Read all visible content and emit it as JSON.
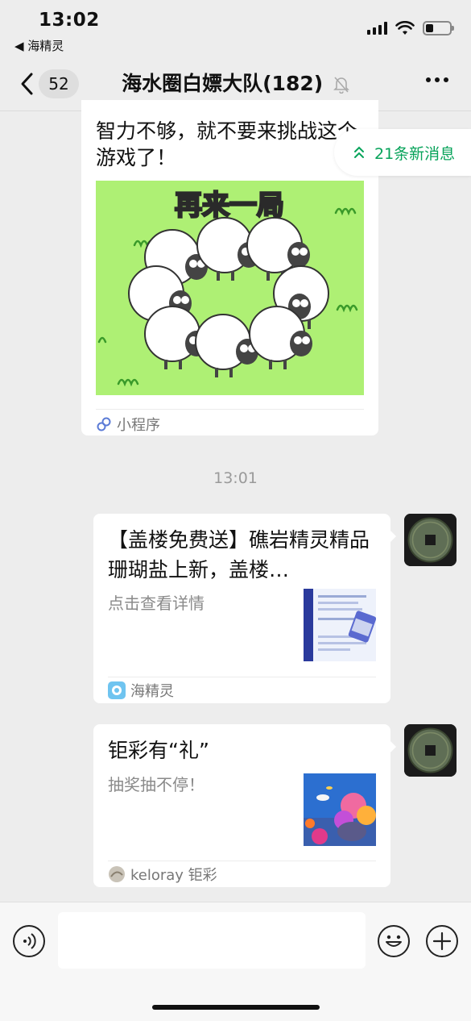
{
  "status_bar": {
    "time": "13:02",
    "back_app": "◀ 海精灵"
  },
  "nav": {
    "unread_count": "52",
    "title": "海水圈白嫖大队",
    "member_count": "(182)"
  },
  "new_messages": {
    "label": "21条新消息"
  },
  "messages": [
    {
      "text": "智力不够，就不要来挑战这个游戏了！",
      "image_caption": "再来一局",
      "footer": "小程序"
    },
    {
      "title": "【盖楼免费送】礁岩精灵精品珊瑚盐上新，盖楼…",
      "desc": "点击查看详情",
      "footer": "海精灵"
    },
    {
      "title": "钜彩有“礼”",
      "desc": "抽奖抽不停！",
      "footer": "keloray 钜彩"
    }
  ],
  "timestamp": "13:01",
  "colors": {
    "accent_green": "#07a35a",
    "chat_bg": "#ededed",
    "game_bg": "#aef074"
  }
}
